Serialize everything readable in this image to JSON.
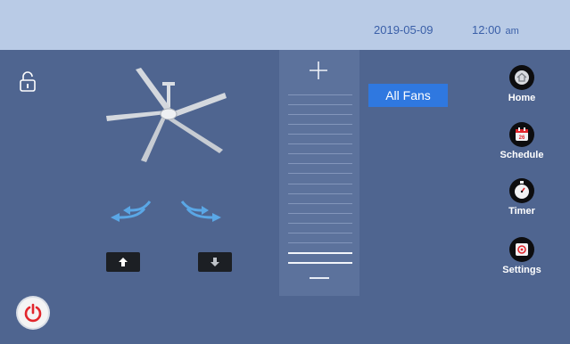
{
  "status_bar": {
    "date": "2019-05-09",
    "time": "12:00",
    "ampm": "am"
  },
  "fan_control": {
    "all_fans_label": "All Fans",
    "speed_plus": "+",
    "speed_levels_total": 18,
    "speed_level_current": 2
  },
  "nav": {
    "items": [
      {
        "label": "Home",
        "icon": "home-icon"
      },
      {
        "label": "Schedule",
        "icon": "calendar-icon"
      },
      {
        "label": "Timer",
        "icon": "stopwatch-icon"
      },
      {
        "label": "Settings",
        "icon": "gear-icon"
      }
    ]
  },
  "colors": {
    "status_bar_bg": "#b9cbe6",
    "panel_bg": "#4f6590",
    "accent_blue": "#2f78e0",
    "power_red": "#e2262c",
    "airflow_blue": "#5aa7e6"
  }
}
